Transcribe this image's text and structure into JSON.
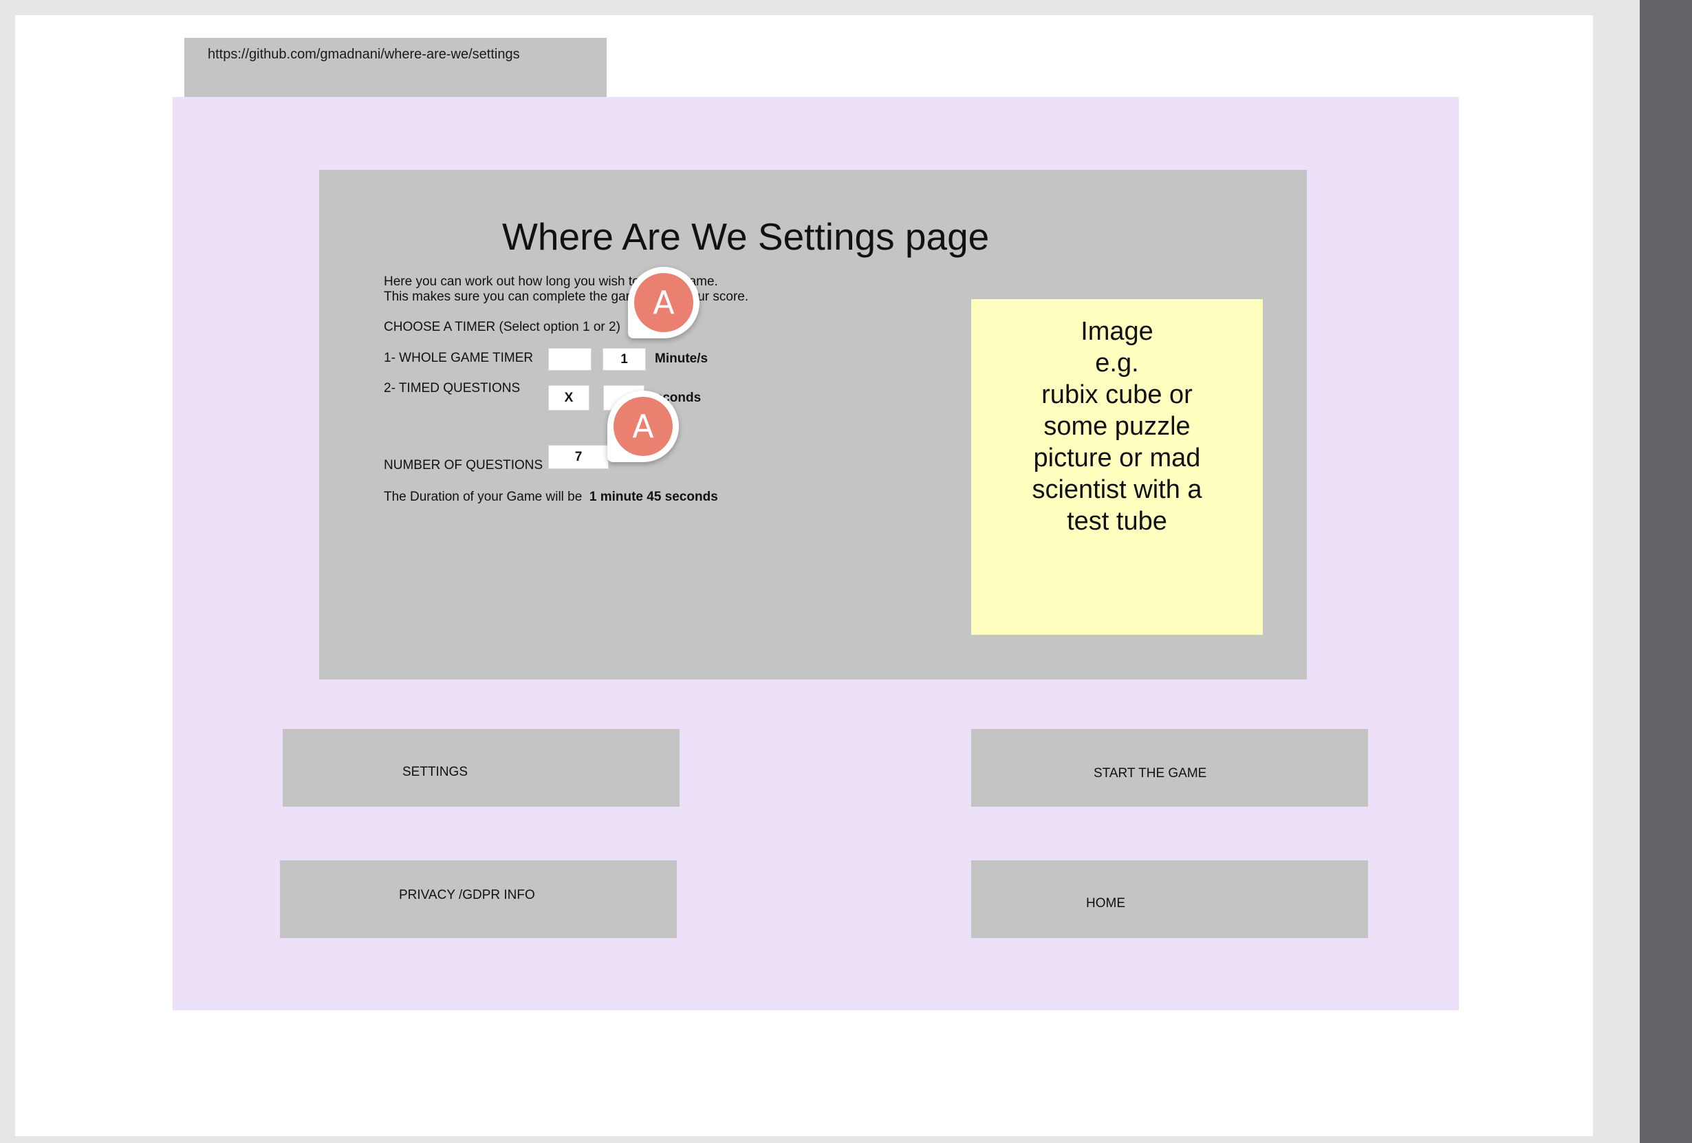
{
  "browser": {
    "url": "https://github.com/gmadnani/where-are-we/settings"
  },
  "page": {
    "title": "Where Are We  Settings page",
    "intro_line1": "Here you can work out how long you wish to play a game.",
    "intro_line2": "This makes sure you can complete the game to get your score."
  },
  "timer": {
    "choose_label": "CHOOSE A TIMER (Select option 1 or 2)",
    "whole_game_label": "1- WHOLE GAME TIMER",
    "whole_game_check": "",
    "whole_game_minutes": "1",
    "minutes_unit": "Minute/s",
    "timed_questions_label": "2- TIMED QUESTIONS",
    "timed_questions_check": "X",
    "timed_questions_seconds": "",
    "seconds_unit": "Seconds"
  },
  "questions": {
    "label": "NUMBER OF QUESTIONS",
    "value": "7"
  },
  "duration": {
    "prefix": "The Duration of your Game will be",
    "value": "1 minute 45 seconds"
  },
  "sticky_note": {
    "text": "Image\ne.g.\nrubix cube or\nsome puzzle\npicture or mad\nscientist with a\ntest tube"
  },
  "buttons": {
    "settings": "SETTINGS",
    "start_game": "START  THE GAME",
    "privacy": "PRIVACY /GDPR INFO",
    "home": "HOME"
  },
  "collaborators": [
    {
      "initial": "A",
      "color": "#ea8170"
    },
    {
      "initial": "A",
      "color": "#ea8170"
    }
  ]
}
